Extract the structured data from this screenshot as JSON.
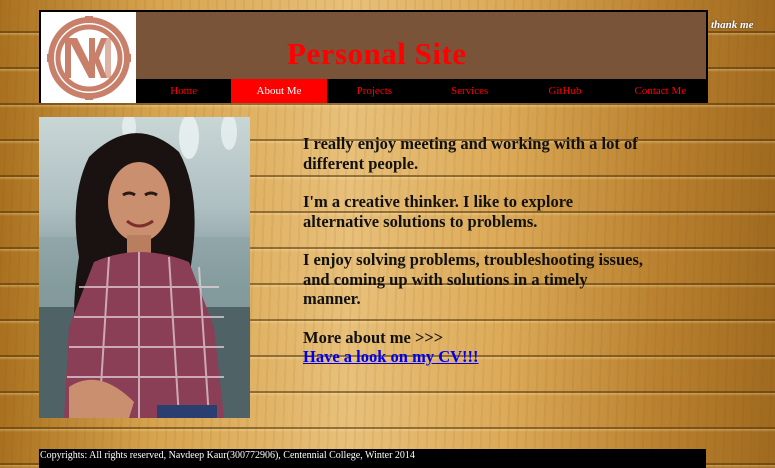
{
  "header": {
    "title": "Personal Site",
    "logo_text": "NK"
  },
  "nav": {
    "items": [
      "Home",
      "About Me",
      "Projects",
      "Services",
      "GitHub",
      "Contact Me"
    ],
    "active": "About Me"
  },
  "corner_text": "thank me",
  "content": {
    "paragraphs": [
      "I really enjoy meeting and working with a lot of different people.",
      "I'm a creative thinker. I like to explore alternative solutions to problems.",
      "I enjoy solving problems, troubleshooting issues, and coming up with solutions in a timely manner."
    ],
    "more_label": "More about me >>>",
    "cv_link": "Have a look on my CV!!!"
  },
  "footer": {
    "text": "Copyrights: All rights reserved, Navdeep Kaur(300772906), Centennial College, Winter 2014"
  },
  "colors": {
    "header_bg": "#7a5438",
    "title_red": "#ff0000",
    "nav_bg": "#000000",
    "nav_active_bg": "#ff0000",
    "link_blue": "#0000ee"
  }
}
